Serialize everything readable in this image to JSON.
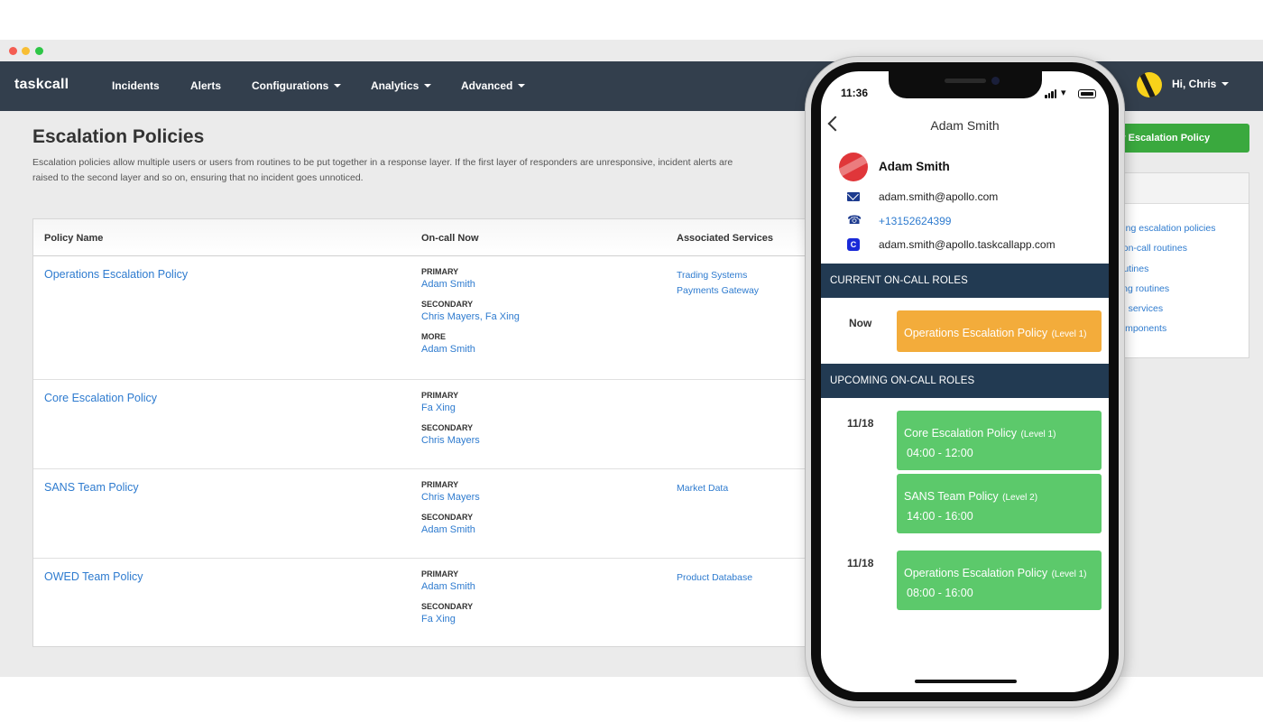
{
  "browser": {
    "brand": "taskcall",
    "nav": [
      {
        "label": "Incidents",
        "has_caret": false
      },
      {
        "label": "Alerts",
        "has_caret": false
      },
      {
        "label": "Configurations",
        "has_caret": true
      },
      {
        "label": "Analytics",
        "has_caret": true
      },
      {
        "label": "Advanced",
        "has_caret": true
      }
    ],
    "user_greeting": "Hi, Chris"
  },
  "page": {
    "title": "Escalation Policies",
    "description": "Escalation policies allow multiple users or users from routines to be put together in a response layer. If the first layer of responders are unresponsive, incident alerts are raised to the second layer and so on, ensuring that no incident goes unnoticed.",
    "new_policy_button": "w Escalation Policy",
    "help_links": [
      "uring escalation policies",
      "g on-call routines",
      "routines",
      "ding routines",
      "ng services",
      "components"
    ]
  },
  "table": {
    "headers": {
      "policy_name": "Policy Name",
      "on_call_now": "On-call Now",
      "associated_services": "Associated Services"
    },
    "rows": [
      {
        "name": "Operations Escalation Policy",
        "roles": [
          {
            "label": "PRIMARY",
            "value": "Adam Smith"
          },
          {
            "label": "SECONDARY",
            "value": "Chris Mayers, Fa Xing"
          },
          {
            "label": "MORE",
            "value": "Adam Smith"
          }
        ],
        "services": [
          "Trading Systems",
          "Payments Gateway"
        ]
      },
      {
        "name": "Core Escalation Policy",
        "roles": [
          {
            "label": "PRIMARY",
            "value": "Fa Xing"
          },
          {
            "label": "SECONDARY",
            "value": "Chris Mayers"
          }
        ],
        "services": []
      },
      {
        "name": "SANS Team Policy",
        "roles": [
          {
            "label": "PRIMARY",
            "value": "Chris Mayers"
          },
          {
            "label": "SECONDARY",
            "value": "Adam Smith"
          }
        ],
        "services": [
          "Market Data"
        ]
      },
      {
        "name": "OWED Team Policy",
        "roles": [
          {
            "label": "PRIMARY",
            "value": "Adam Smith"
          },
          {
            "label": "SECONDARY",
            "value": "Fa Xing"
          }
        ],
        "services": [
          "Product Database"
        ]
      }
    ]
  },
  "mobile": {
    "status_time": "11:36",
    "title": "Adam Smith",
    "user_name": "Adam Smith",
    "email": "adam.smith@apollo.com",
    "phone": "+13152624399",
    "taskcall_email": "adam.smith@apollo.taskcallapp.com",
    "current_header": "CURRENT ON-CALL ROLES",
    "current_label": "Now",
    "current_role": {
      "policy": "Operations Escalation Policy",
      "level": "(Level 1)"
    },
    "upcoming_header": "UPCOMING ON-CALL ROLES",
    "upcoming": [
      {
        "date": "11/18",
        "policy": "Core Escalation Policy",
        "level": "(Level 1)",
        "hours": "04:00 - 12:00"
      },
      {
        "date": "",
        "policy": "SANS Team Policy",
        "level": "(Level 2)",
        "hours": "14:00 - 16:00"
      },
      {
        "date": "11/18",
        "policy": "Operations Escalation Policy",
        "level": "(Level 1)",
        "hours": "08:00 - 16:00"
      }
    ]
  },
  "colors": {
    "navbar": "#333f4d",
    "link": "#2e7bcf",
    "button_green": "#3aa93e",
    "section_bar": "#223a52",
    "role_orange": "#f3ac3b",
    "role_green": "#5cc96b"
  }
}
